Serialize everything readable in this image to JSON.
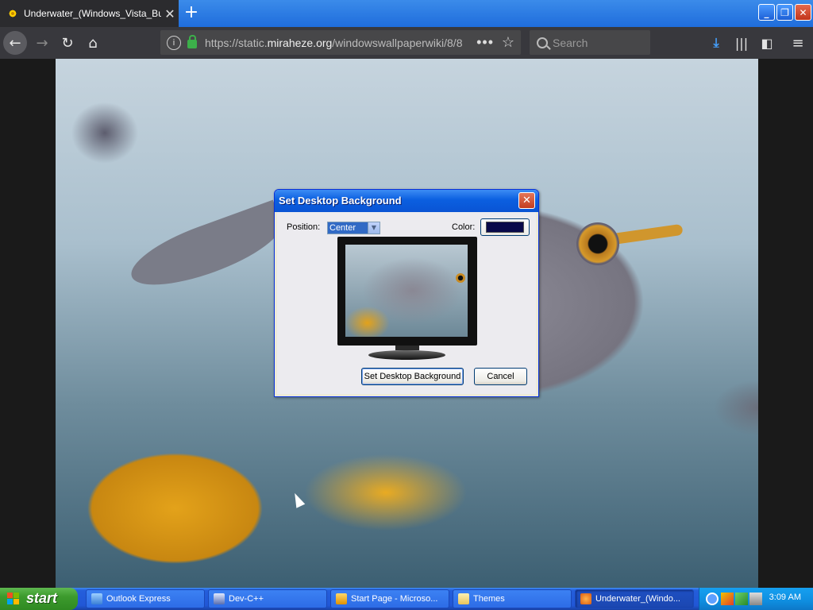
{
  "browser": {
    "tab_title": "Underwater_(Windows_Vista_Buil",
    "tab_close": "✕",
    "new_tab": "+",
    "url_prefix": "https://static.",
    "url_domain": "miraheze.org",
    "url_path": "/windowswallpaperwiki/8/8",
    "url_dots": "•••",
    "search_placeholder": "Search",
    "window_buttons": {
      "minimize": "_",
      "restore": "❐",
      "close": "✕"
    }
  },
  "dialog": {
    "title": "Set Desktop Background",
    "position_label": "Position:",
    "position_value": "Center",
    "color_label": "Color:",
    "color_value": "#0a0a4a",
    "ok_label": "Set Desktop Background",
    "cancel_label": "Cancel"
  },
  "taskbar": {
    "start_label": "start",
    "items": [
      {
        "label": "Outlook Express",
        "icon": "outlook-express-icon"
      },
      {
        "label": "Dev-C++",
        "icon": "dev-cpp-icon"
      },
      {
        "label": "Start Page - Microso...",
        "icon": "ie-icon"
      },
      {
        "label": "Themes",
        "icon": "folder-icon"
      },
      {
        "label": "Underwater_(Windo...",
        "icon": "firefox-icon"
      }
    ],
    "clock": "3:09 AM"
  },
  "colors": {
    "xp_blue": "#245edb",
    "start_green": "#3c9a2d",
    "firefox_dark": "#38383d"
  }
}
